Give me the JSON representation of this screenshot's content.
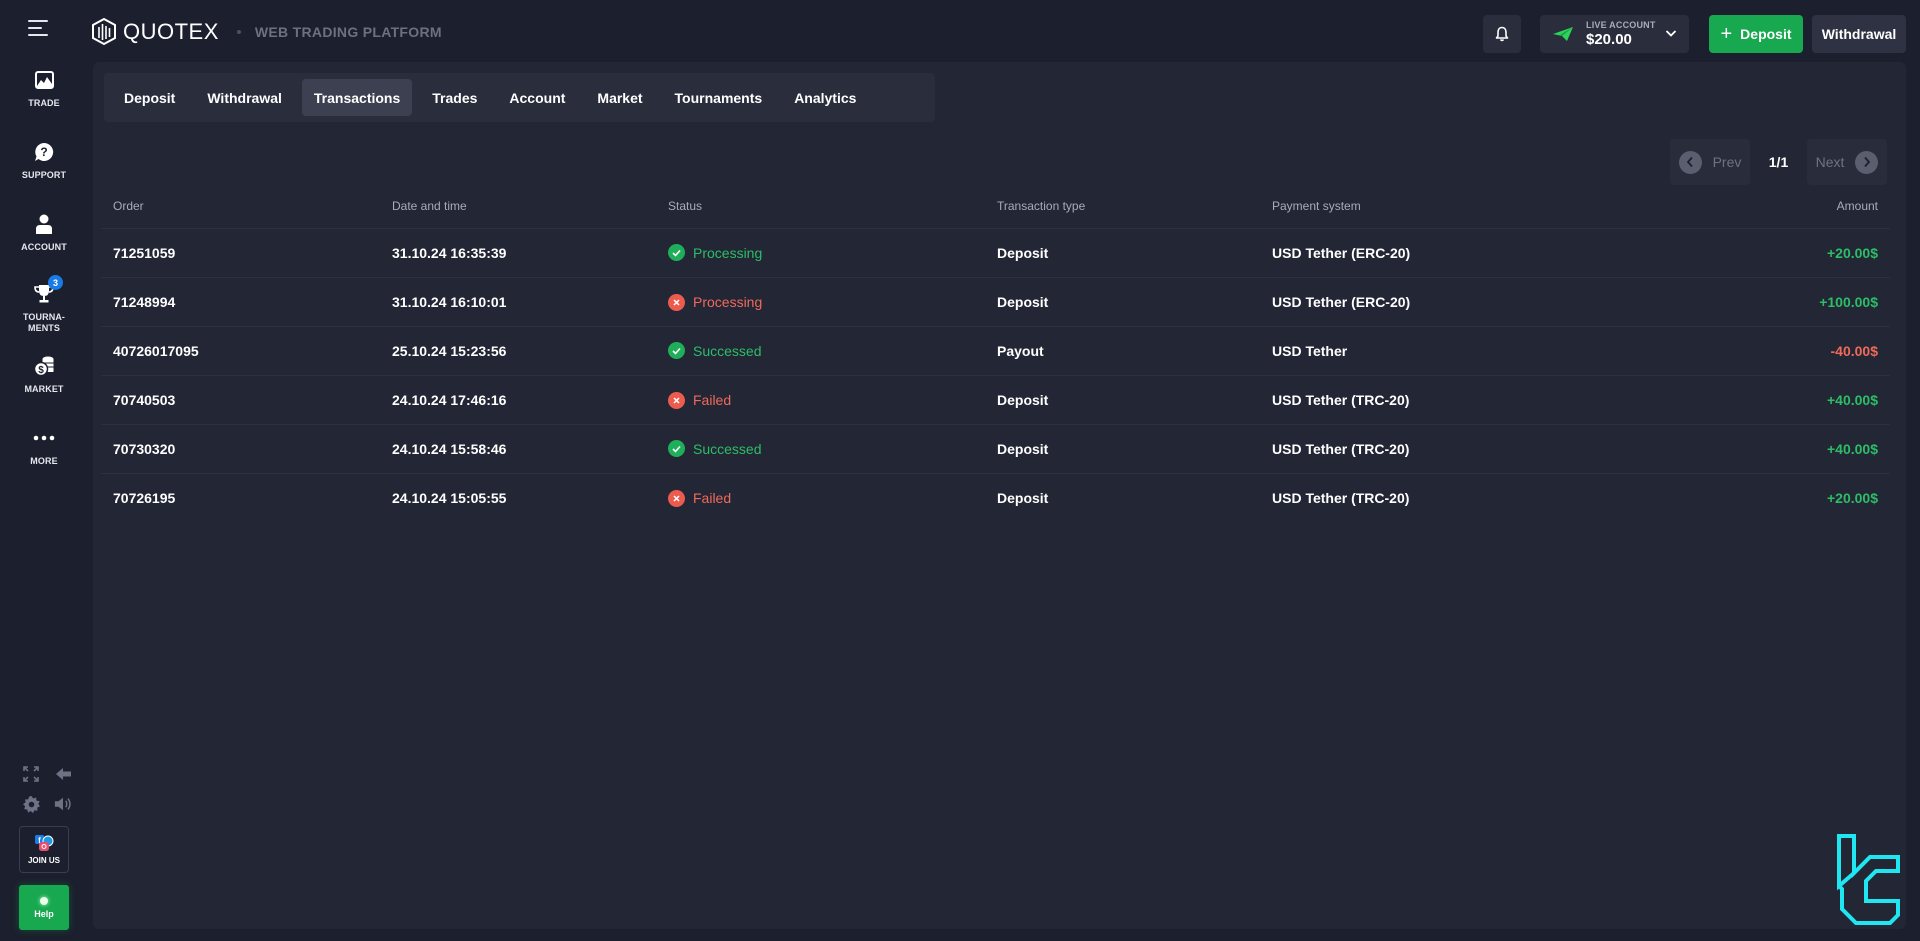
{
  "header": {
    "brand": "QUOTEX",
    "subtitle": "WEB TRADING PLATFORM",
    "account_label": "LIVE ACCOUNT",
    "account_balance": "$20.00",
    "deposit_label": "Deposit",
    "withdrawal_label": "Withdrawal"
  },
  "sidebar": {
    "items": [
      {
        "label": "TRADE",
        "icon": "chart-image-icon"
      },
      {
        "label": "SUPPORT",
        "icon": "question-bubble-icon"
      },
      {
        "label": "ACCOUNT",
        "icon": "user-icon"
      },
      {
        "label": "TOURNA-\nMENTS",
        "icon": "trophy-icon",
        "badge": "3"
      },
      {
        "label": "MARKET",
        "icon": "coins-icon"
      },
      {
        "label": "MORE",
        "icon": "more-dots-icon"
      }
    ],
    "join_label": "JOIN US",
    "help_label": "Help"
  },
  "tabs": [
    {
      "label": "Deposit",
      "active": false
    },
    {
      "label": "Withdrawal",
      "active": false
    },
    {
      "label": "Transactions",
      "active": true
    },
    {
      "label": "Trades",
      "active": false
    },
    {
      "label": "Account",
      "active": false
    },
    {
      "label": "Market",
      "active": false
    },
    {
      "label": "Tournaments",
      "active": false
    },
    {
      "label": "Analytics",
      "active": false
    }
  ],
  "pagination": {
    "prev_label": "Prev",
    "next_label": "Next",
    "page": "1/1"
  },
  "table": {
    "columns": [
      "Order",
      "Date and time",
      "Status",
      "Transaction type",
      "Payment system",
      "Amount"
    ],
    "rows": [
      {
        "order": "71251059",
        "datetime": "31.10.24 16:35:39",
        "status": "Processing",
        "status_kind": "ok",
        "type": "Deposit",
        "payment": "USD Tether (ERC-20)",
        "amount": "+20.00$",
        "amount_kind": "pos"
      },
      {
        "order": "71248994",
        "datetime": "31.10.24 16:10:01",
        "status": "Processing",
        "status_kind": "bad",
        "type": "Deposit",
        "payment": "USD Tether (ERC-20)",
        "amount": "+100.00$",
        "amount_kind": "pos"
      },
      {
        "order": "40726017095",
        "datetime": "25.10.24 15:23:56",
        "status": "Successed",
        "status_kind": "ok",
        "type": "Payout",
        "payment": "USD Tether",
        "amount": "-40.00$",
        "amount_kind": "neg"
      },
      {
        "order": "70740503",
        "datetime": "24.10.24 17:46:16",
        "status": "Failed",
        "status_kind": "bad",
        "type": "Deposit",
        "payment": "USD Tether (TRC-20)",
        "amount": "+40.00$",
        "amount_kind": "pos"
      },
      {
        "order": "70730320",
        "datetime": "24.10.24 15:58:46",
        "status": "Successed",
        "status_kind": "ok",
        "type": "Deposit",
        "payment": "USD Tether (TRC-20)",
        "amount": "+40.00$",
        "amount_kind": "pos"
      },
      {
        "order": "70726195",
        "datetime": "24.10.24 15:05:55",
        "status": "Failed",
        "status_kind": "bad",
        "type": "Deposit",
        "payment": "USD Tether (TRC-20)",
        "amount": "+20.00$",
        "amount_kind": "pos"
      }
    ]
  },
  "colors": {
    "accent_green": "#18a84f",
    "status_ok": "#2dbd68",
    "status_bad": "#ef6a5b",
    "badge_blue": "#1b7be6",
    "watermark_cyan": "#1fe6f0"
  }
}
